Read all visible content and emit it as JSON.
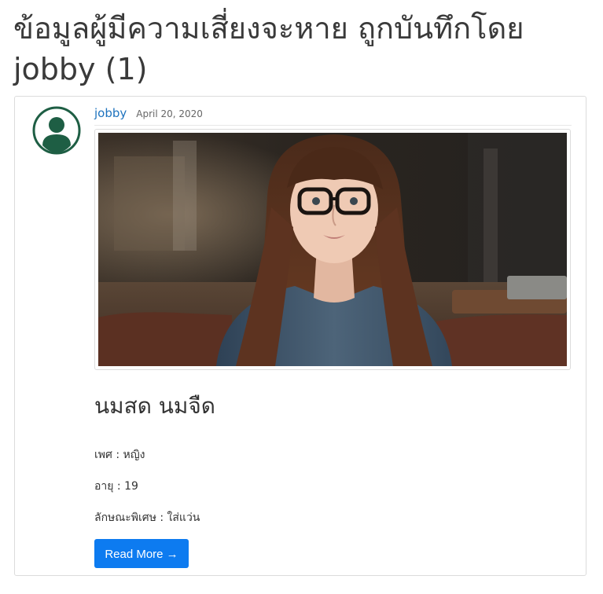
{
  "page": {
    "title": "ข้อมูลผู้มีความเสี่ยงจะหาย ถูกบันทึกโดย jobby (1)"
  },
  "post": {
    "author": "jobby",
    "date": "April 20, 2020",
    "title": "นมสด นมจืด",
    "fields": {
      "gender": "เพศ : หญิง",
      "age": "อายุ : 19",
      "features": "ลักษณะพิเศษ : ใส่แว่น"
    },
    "read_more_label": "Read More →"
  },
  "icons": {
    "avatar": "user-avatar-icon"
  },
  "colors": {
    "link": "#1e73be",
    "button": "#0d7bf0",
    "avatar": "#1e5e44"
  }
}
